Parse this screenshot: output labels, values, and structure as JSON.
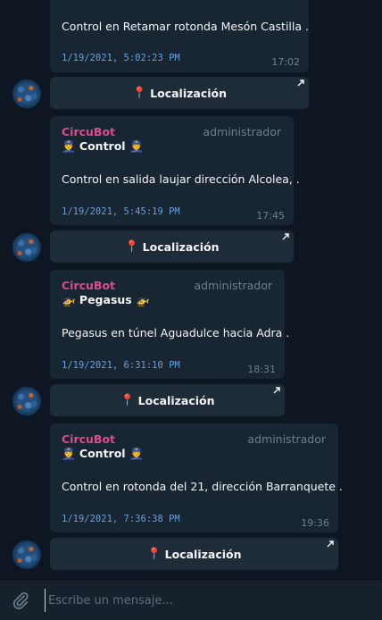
{
  "messages": [
    {
      "sender": "",
      "role": "",
      "title": "",
      "body": "Control en Retamar rotonda Mesón Castilla .",
      "stamp": "1/19/2021, 5:02:23 PM",
      "time": "17:02"
    },
    {
      "sender": "CircuBot",
      "role": "administrador",
      "title": "👮 Control 👮",
      "body": "Control en salida laujar dirección Alcolea, .",
      "stamp": "1/19/2021, 5:45:19 PM",
      "time": "17:45"
    },
    {
      "sender": "CircuBot",
      "role": "administrador",
      "title": "🚁 Pegasus 🚁",
      "body": "Pegasus en túnel Aguadulce hacia Adra .",
      "stamp": "1/19/2021, 6:31:10 PM",
      "time": "18:31"
    },
    {
      "sender": "CircuBot",
      "role": "administrador",
      "title": "👮 Control 👮",
      "body": "Control en rotonda del 21, dirección Barranquete .",
      "stamp": "1/19/2021, 7:36:38 PM",
      "time": "19:36"
    }
  ],
  "location_button": {
    "pin": "📍",
    "label": "Localización"
  },
  "composer": {
    "placeholder": "Escribe un mensaje..."
  },
  "colors": {
    "background": "#0e1621",
    "bubble": "#182533",
    "sender": "#dd4b8a",
    "stamp": "#6c9fd8",
    "muted": "#6d7f8f"
  }
}
